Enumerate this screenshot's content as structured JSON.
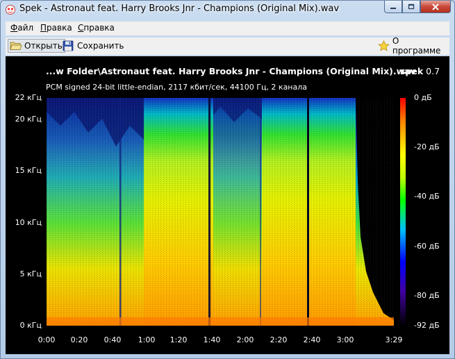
{
  "window": {
    "title": "Spek - Astronaut feat. Harry Brooks Jnr - Champions (Original Mix).wav"
  },
  "menu": [
    {
      "label": "Файл",
      "key": "Ф",
      "rest": "айл"
    },
    {
      "label": "Правка",
      "key": "П",
      "rest": "равка"
    },
    {
      "label": "Справка",
      "key": "С",
      "rest": "правка"
    }
  ],
  "toolbar": {
    "open_label": "Открыть",
    "save_label": "Сохранить",
    "about_label": "О программе"
  },
  "file": {
    "title": "...w Folder\\Astronaut feat. Harry Brooks Jnr - Champions (Original Mix).wav",
    "info": "PCM signed 24-bit little-endian, 2117 кбит/сек, 44100 Гц, 2 канала"
  },
  "app": {
    "name": "spek",
    "version": "0.7"
  },
  "colors": {
    "background": "#000000",
    "text": "#ffffff",
    "window_frame": "#b9cfe8"
  },
  "icons": {
    "app": "spek-icon",
    "open": "folder-open-icon",
    "save": "floppy-disk-icon",
    "about": "star-icon"
  },
  "chart_data": {
    "type": "heatmap",
    "x_ticks": [
      "0:00",
      "0:20",
      "0:40",
      "1:00",
      "1:20",
      "1:40",
      "2:00",
      "2:20",
      "2:40",
      "3:00",
      "3:29"
    ],
    "y_ticks": [
      "22 кГц",
      "20 кГц",
      "15 кГц",
      "10 кГц",
      "5 кГц",
      "0 кГц"
    ],
    "colorbar_ticks": [
      "0 дБ",
      "-20 дБ",
      "-40 дБ",
      "-60 дБ",
      "-80 дБ",
      "-92 дБ"
    ],
    "x_range_seconds": [
      0,
      209
    ],
    "y_range_khz": [
      0,
      22
    ],
    "db_range": [
      -92,
      0
    ]
  }
}
